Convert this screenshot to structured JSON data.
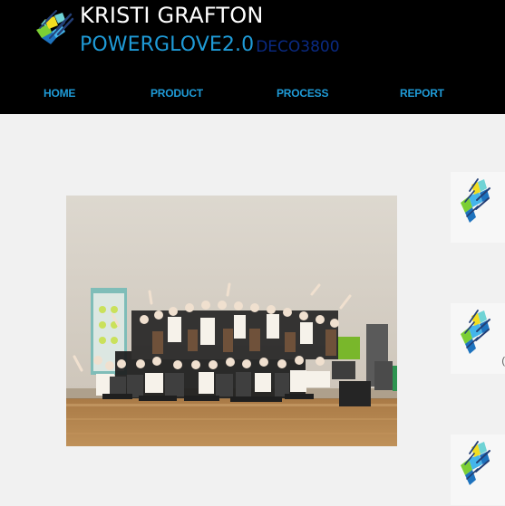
{
  "header": {
    "site_name": "KRISTI GRAFTON",
    "tagline_main": "POWERGLOVE2.0",
    "tagline_code": "DECO3800",
    "logo_icon": "glove-logo-icon"
  },
  "nav": {
    "items": [
      {
        "label": "HOME"
      },
      {
        "label": "PRODUCT"
      },
      {
        "label": "PROCESS"
      },
      {
        "label": "REPORT"
      }
    ]
  },
  "content": {
    "photo_icon": "group-photo-image"
  },
  "sidebar": {
    "cards": [
      {
        "icon": "glove-logo-icon"
      },
      {
        "icon": "glove-logo-icon"
      },
      {
        "icon": "glove-logo-icon"
      }
    ]
  },
  "colors": {
    "header_bg": "#000000",
    "accent": "#1f9bd7",
    "code_text": "#0a2a83",
    "page_bg": "#f1f1f1"
  }
}
